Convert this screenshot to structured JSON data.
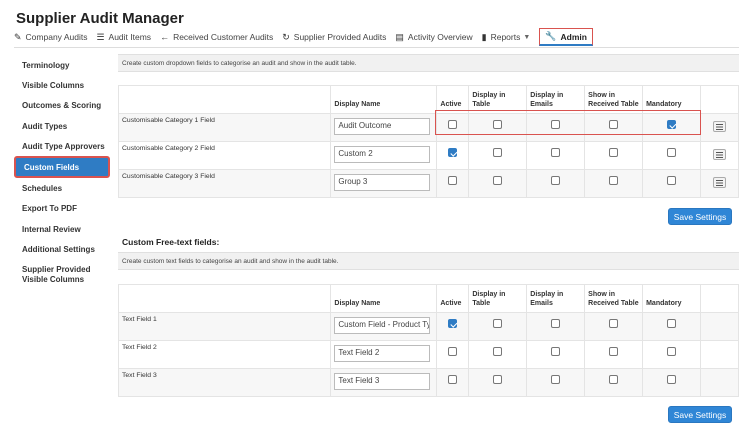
{
  "app": {
    "title": "Supplier Audit Manager"
  },
  "tabs": [
    {
      "label": "Company Audits",
      "icon": "edit-icon"
    },
    {
      "label": "Audit Items",
      "icon": "list-icon"
    },
    {
      "label": "Received Customer Audits",
      "icon": "arrow-left-icon"
    },
    {
      "label": "Supplier Provided Audits",
      "icon": "refresh-icon"
    },
    {
      "label": "Activity Overview",
      "icon": "table-icon"
    },
    {
      "label": "Reports",
      "icon": "file-icon"
    },
    {
      "label": "Admin",
      "icon": "wrench-icon"
    }
  ],
  "sidebar": {
    "items": [
      {
        "label": "Terminology"
      },
      {
        "label": "Visible Columns"
      },
      {
        "label": "Outcomes & Scoring"
      },
      {
        "label": "Audit Types"
      },
      {
        "label": "Audit Type Approvers"
      },
      {
        "label": "Custom Fields"
      },
      {
        "label": "Schedules"
      },
      {
        "label": "Export To PDF"
      },
      {
        "label": "Internal Review"
      },
      {
        "label": "Additional Settings"
      },
      {
        "label": "Supplier Provided Visible Columns"
      }
    ]
  },
  "dropdown_section": {
    "info": "Create custom dropdown fields to categorise an audit and show in the audit table.",
    "headers": [
      "",
      "Display Name",
      "Active",
      "Display in Table",
      "Display in Emails",
      "Show in Received Table",
      "Mandatory",
      ""
    ],
    "rows": [
      {
        "label": "Customisable Category 1 Field",
        "value": "Audit Outcome",
        "active": false,
        "table": false,
        "emails": false,
        "received": false,
        "mandatory": true
      },
      {
        "label": "Customisable Category 2 Field",
        "value": "Custom 2",
        "active": true,
        "table": false,
        "emails": false,
        "received": false,
        "mandatory": false
      },
      {
        "label": "Customisable Category 3 Field",
        "value": "Group 3",
        "active": false,
        "table": false,
        "emails": false,
        "received": false,
        "mandatory": false
      }
    ],
    "save_label": "Save Settings"
  },
  "text_section": {
    "title": "Custom Free-text fields:",
    "info": "Create custom text fields to categorise an audit and show in the audit table.",
    "headers": [
      "",
      "Display Name",
      "Active",
      "Display in Table",
      "Display in Emails",
      "Show in Received Table",
      "Mandatory",
      ""
    ],
    "rows": [
      {
        "label": "Text Field 1",
        "value": "Custom Field - Product Ty",
        "active": true,
        "table": false,
        "emails": false,
        "received": false,
        "mandatory": false
      },
      {
        "label": "Text Field 2",
        "value": "Text Field 2",
        "active": false,
        "table": false,
        "emails": false,
        "received": false,
        "mandatory": false
      },
      {
        "label": "Text Field 3",
        "value": "Text Field 3",
        "active": false,
        "table": false,
        "emails": false,
        "received": false,
        "mandatory": false
      }
    ],
    "save_label": "Save Settings"
  },
  "colors": {
    "primary": "#2f7cc4",
    "highlight": "#d9534f",
    "button": "#2f86d6"
  }
}
